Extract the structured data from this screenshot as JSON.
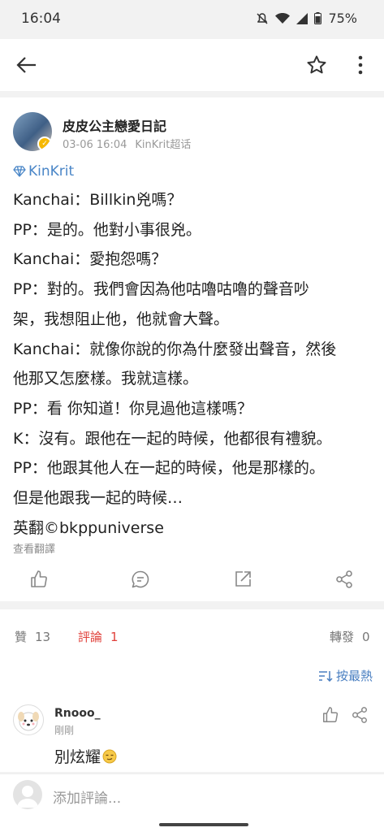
{
  "status": {
    "time": "16:04",
    "battery": "75%"
  },
  "post": {
    "author": "皮皮公主戀愛日記",
    "date": "03-06 16:04",
    "source": "KinKrit超话",
    "topic": "KinKrit",
    "lines": [
      "Kanchai：Billkin兇嗎？",
      "PP：是的。他對小事很兇。",
      "Kanchai：愛抱怨嗎？",
      "PP：對的。我們會因為他咕嚕咕嚕的聲音吵",
      "架，我想阻止他，他就會大聲。",
      "Kanchai：就像你說的你為什麼發出聲音，然後",
      "他那又怎麼樣。我就這樣。",
      "PP：看 你知道！你見過他這樣嗎？",
      "K：沒有。跟他在一起的時候，他都很有禮貌。",
      "PP：他跟其他人在一起的時候，他是那樣的。",
      "但是他跟我一起的時候…",
      "英翻©bkppuniverse"
    ],
    "translate": "查看翻譯"
  },
  "stats": {
    "like_label": "贊",
    "like_count": "13",
    "comment_label": "評論",
    "comment_count": "1",
    "repost_label": "轉發",
    "repost_count": "0",
    "sort_label": "按最熱"
  },
  "comment": {
    "name": "Rnooo_",
    "time": "剛剛",
    "text": "別炫耀"
  },
  "input": {
    "placeholder": "添加評論..."
  },
  "colors": {
    "link": "#4a86c7",
    "accent_red": "#e0403a",
    "sort_blue": "#4a7fc1"
  },
  "icons": [
    "back-arrow-icon",
    "star-icon",
    "more-vertical-icon",
    "like-icon",
    "comment-icon",
    "repost-icon",
    "share-icon",
    "sort-icon",
    "diamond-icon"
  ]
}
